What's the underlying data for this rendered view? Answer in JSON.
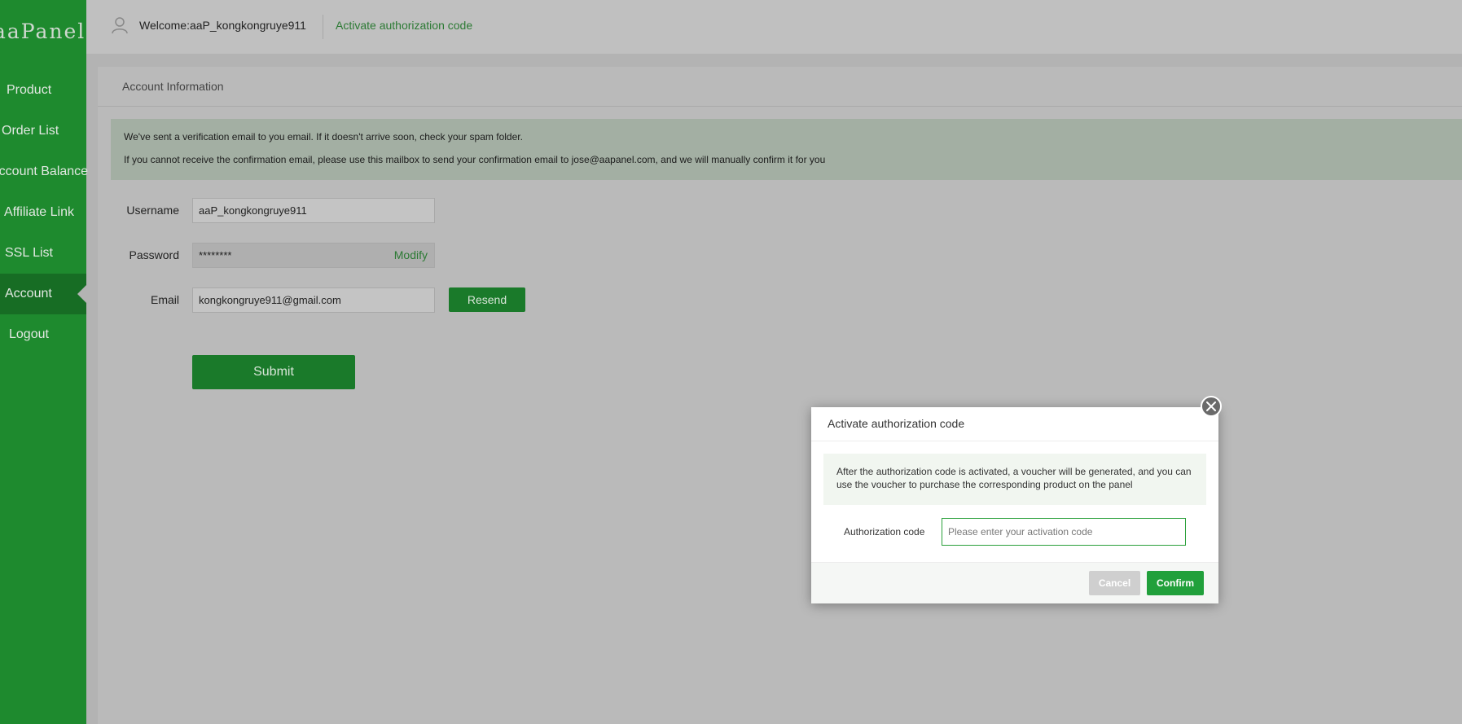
{
  "brand": {
    "logo_text": "aaPanel"
  },
  "sidebar": {
    "items": [
      {
        "label": "Product",
        "active": false
      },
      {
        "label": "Order List",
        "active": false
      },
      {
        "label": "Account Balance",
        "active": false
      },
      {
        "label": "Affiliate Link",
        "active": false
      },
      {
        "label": "SSL List",
        "active": false
      },
      {
        "label": "Account",
        "active": true
      },
      {
        "label": "Logout",
        "active": false
      }
    ]
  },
  "header": {
    "welcome": "Welcome:aaP_kongkongruye911",
    "activate_link": "Activate authorization code"
  },
  "account": {
    "title": "Account Information",
    "notice_line1": "We've sent a verification email to you email. If it doesn't arrive soon, check your spam folder.",
    "notice_line2": "If you cannot receive the confirmation email, please use this mailbox to send your confirmation email to jose@aapanel.com, and we will manually confirm it for you",
    "username_label": "Username",
    "username_value": "aaP_kongkongruye911",
    "password_label": "Password",
    "password_value": "********",
    "modify_label": "Modify",
    "email_label": "Email",
    "email_value": "kongkongruye911@gmail.com",
    "resend_label": "Resend",
    "submit_label": "Submit"
  },
  "modal": {
    "title": "Activate authorization code",
    "notice": "After the authorization code is activated, a voucher will be generated, and you can use the voucher to purchase the corresponding product on the panel",
    "code_label": "Authorization code",
    "code_placeholder": "Please enter your activation code",
    "cancel_label": "Cancel",
    "confirm_label": "Confirm"
  },
  "colors": {
    "sidebar_bg": "#1e8a2e",
    "accent_link": "#2c7a34",
    "confirm_bg": "#21a03b"
  }
}
